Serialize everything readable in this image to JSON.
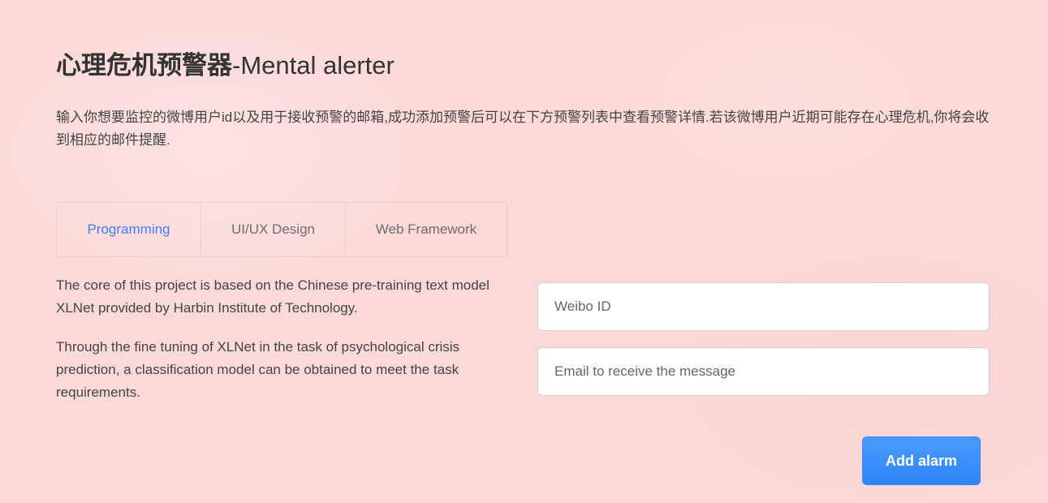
{
  "header": {
    "title_cn": "心理危机预警器",
    "title_en": "-Mental alerter"
  },
  "intro": {
    "text": "输入你想要监控的微博用户id以及用于接收预警的邮箱,成功添加预警后可以在下方预警列表中查看预警详情.若该微博用户近期可能存在心理危机,你将会收到相应的邮件提醒."
  },
  "tabs": [
    {
      "label": "Programming",
      "active": true
    },
    {
      "label": "UI/UX Design",
      "active": false
    },
    {
      "label": "Web Framework",
      "active": false
    }
  ],
  "content": {
    "paragraphs": [
      "The core of this project is based on the Chinese pre-training text model XLNet provided by Harbin Institute of Technology.",
      "Through the fine tuning of XLNet in the task of psychological crisis prediction, a classification model can be obtained to meet the task requirements."
    ]
  },
  "form": {
    "weibo_id_placeholder": "Weibo ID",
    "weibo_id_value": "",
    "email_placeholder": "Email to receive the message",
    "email_value": "",
    "submit_label": "Add alarm"
  },
  "colors": {
    "background": "#fcd9d9",
    "accent": "#3b82f0",
    "button": "#2e86f5"
  }
}
